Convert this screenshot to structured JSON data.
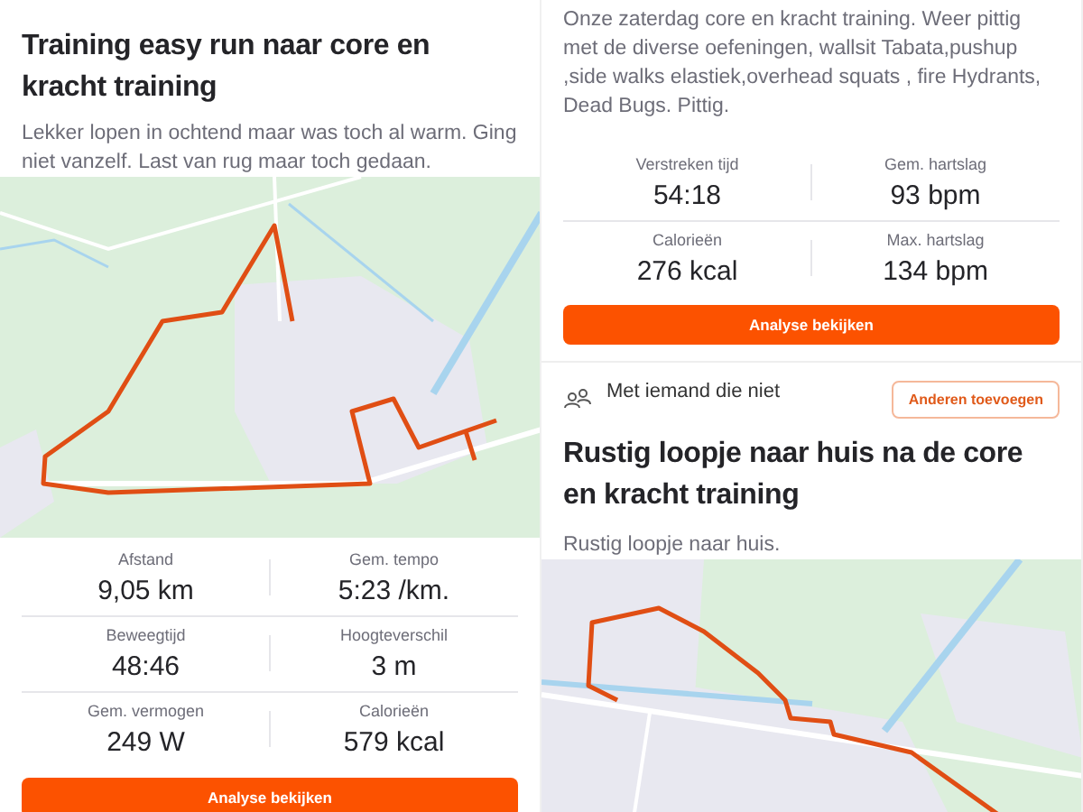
{
  "left": {
    "title": "Training easy run naar core en kracht training",
    "description": "Lekker lopen in ochtend maar was toch al warm. Ging niet vanzelf. Last van rug maar toch gedaan.",
    "stats": [
      {
        "label": "Afstand",
        "value": "9,05 km"
      },
      {
        "label": "Gem. tempo",
        "value": "5:23 /km."
      },
      {
        "label": "Beweegtijd",
        "value": "48:46"
      },
      {
        "label": "Hoogteverschil",
        "value": "3 m"
      },
      {
        "label": "Gem. vermogen",
        "value": "249 W"
      },
      {
        "label": "Calorieën",
        "value": "579 kcal"
      }
    ],
    "button": "Analyse bekijken"
  },
  "right": {
    "description": "Onze zaterdag core en kracht training. Weer pittig met de diverse oefeningen, wallsit Tabata,pushup ,side walks elastiek,overhead squats , fire Hydrants, Dead Bugs. Pittig.",
    "stats": [
      {
        "label": "Verstreken tijd",
        "value": "54:18"
      },
      {
        "label": "Gem. hartslag",
        "value": "93 bpm"
      },
      {
        "label": "Calorieën",
        "value": "276 kcal"
      },
      {
        "label": "Max. hartslag",
        "value": "134 bpm"
      }
    ],
    "button": "Analyse bekijken",
    "invite": {
      "text": "Met iemand die niet",
      "button": "Anderen toevoegen"
    },
    "next": {
      "title": "Rustig loopje naar huis na de core en kracht training",
      "description": "Rustig loopje naar huis."
    }
  }
}
